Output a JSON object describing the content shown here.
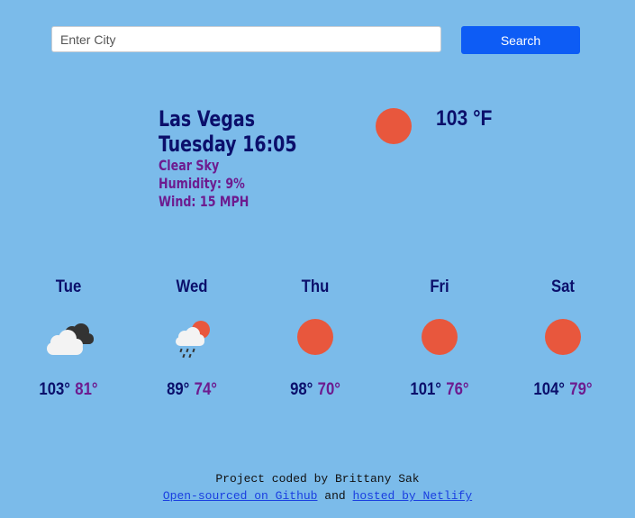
{
  "search": {
    "placeholder": "Enter City",
    "value": "",
    "button_label": "Search"
  },
  "current": {
    "city": "Las Vegas",
    "datetime": "Tuesday 16:05",
    "description": "Clear Sky",
    "humidity": "Humidity: 9%",
    "wind": "Wind: 15 MPH",
    "temperature": "103 °F",
    "icon": "sun-icon"
  },
  "forecast": [
    {
      "day": "Tue",
      "high": "103°",
      "low": "81°",
      "icon": "cloudy-icon"
    },
    {
      "day": "Wed",
      "high": "89°",
      "low": "74°",
      "icon": "rain-sun-icon"
    },
    {
      "day": "Thu",
      "high": "98°",
      "low": "70°",
      "icon": "sun-icon"
    },
    {
      "day": "Fri",
      "high": "101°",
      "low": "76°",
      "icon": "sun-icon"
    },
    {
      "day": "Sat",
      "high": "104°",
      "low": "79°",
      "icon": "sun-icon"
    }
  ],
  "footer": {
    "credit": "Project coded by Brittany Sak",
    "github_link": "Open-sourced on Github",
    "joiner": "and",
    "netlify_link": "hosted by Netlify"
  },
  "colors": {
    "background": "#7bbbea",
    "primary_text": "#0b0f6b",
    "secondary_text": "#6d1b8f",
    "button": "#0d5cf5",
    "sun": "#e8573d"
  }
}
